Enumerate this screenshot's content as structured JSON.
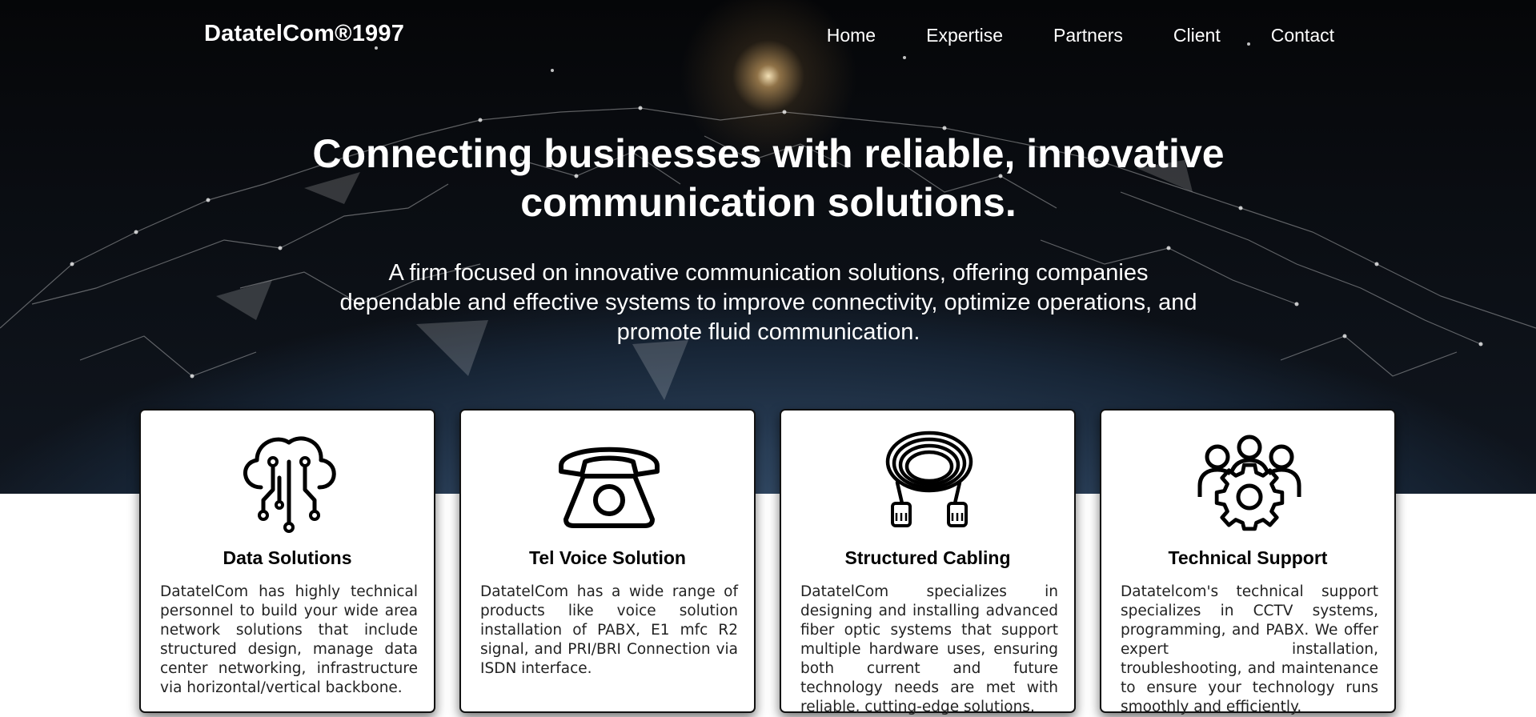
{
  "brand": "DatatelCom®1997",
  "nav": [
    {
      "label": "Home"
    },
    {
      "label": "Expertise"
    },
    {
      "label": "Partners"
    },
    {
      "label": "Client"
    },
    {
      "label": "Contact"
    }
  ],
  "hero": {
    "headline": "Connecting businesses with reliable, innovative communication solutions.",
    "subtitle": "A firm focused on innovative communication solutions, offering companies dependable and effective systems to improve connectivity, optimize operations, and promote fluid communication."
  },
  "services": [
    {
      "icon": "cloud-circuit-icon",
      "title": "Data Solutions",
      "text": "DatatelCom has highly technical personnel to build your wide area network solutions that include structured design, manage data center networking, infrastructure via horizontal/vertical backbone."
    },
    {
      "icon": "telephone-icon",
      "title": "Tel Voice Solution",
      "text": "DatatelCom has a wide range of products like voice solution installation of PABX, E1 mfc R2 signal, and PRI/BRI Connection via ISDN interface."
    },
    {
      "icon": "network-cable-icon",
      "title": "Structured Cabling",
      "text": "DatatelCom specializes in designing and installing advanced fiber optic systems that support multiple hardware uses, ensuring both current and future technology needs are met with reliable, cutting-edge solutions."
    },
    {
      "icon": "team-gear-icon",
      "title": "Technical Support",
      "text": "Datatelcom's technical support specializes in CCTV systems, programming, and PABX. We offer expert installation, troubleshooting, and maintenance to ensure your technology runs smoothly and efficiently."
    }
  ]
}
